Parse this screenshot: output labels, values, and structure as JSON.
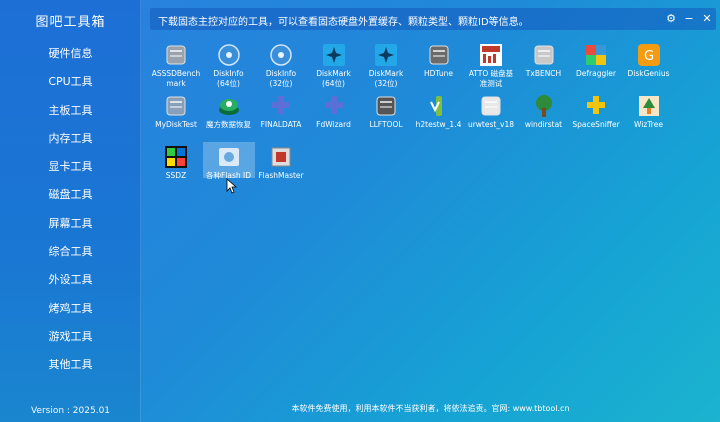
{
  "app": {
    "title": "图吧工具箱",
    "version": "Version : 2025.01"
  },
  "sidebar": {
    "items": [
      {
        "label": "硬件信息"
      },
      {
        "label": "CPU工具"
      },
      {
        "label": "主板工具"
      },
      {
        "label": "内存工具"
      },
      {
        "label": "显卡工具"
      },
      {
        "label": "磁盘工具"
      },
      {
        "label": "屏幕工具"
      },
      {
        "label": "综合工具"
      },
      {
        "label": "外设工具"
      },
      {
        "label": "烤鸡工具"
      },
      {
        "label": "游戏工具"
      },
      {
        "label": "其他工具"
      }
    ]
  },
  "header": {
    "description": "下载固态主控对应的工具，可以查看固态硬盘外置缓存、颗粒类型、颗粒ID等信息。",
    "settings": "⚙",
    "minimize": "−",
    "close": "✕"
  },
  "tools": [
    {
      "label": "ASSSDBench\nmark",
      "icon": "asssd-icon",
      "color": "#9aa3ad"
    },
    {
      "label": "DiskInfo\n(64位)",
      "icon": "diskinfo-icon",
      "color": "#3b8fd8"
    },
    {
      "label": "DiskInfo\n(32位)",
      "icon": "diskinfo-icon",
      "color": "#3b8fd8"
    },
    {
      "label": "DiskMark\n(64位)",
      "icon": "diskmark-icon",
      "color": "#22a7e8"
    },
    {
      "label": "DiskMark\n(32位)",
      "icon": "diskmark-icon",
      "color": "#22a7e8"
    },
    {
      "label": "HDTune",
      "icon": "hdtune-icon",
      "color": "#6b6b6b"
    },
    {
      "label": "ATTO 磁盘基\n准测试",
      "icon": "atto-icon",
      "color": "#c0392b"
    },
    {
      "label": "TxBENCH",
      "icon": "txbench-icon",
      "color": "#c8c8c8"
    },
    {
      "label": "Defraggler",
      "icon": "defraggler-icon",
      "color": "#e74c3c"
    },
    {
      "label": "DiskGenius",
      "icon": "diskgenius-icon",
      "color": "#f39c12"
    },
    {
      "label": "MyDiskTest",
      "icon": "mydisktest-icon",
      "color": "#8aa0b8"
    },
    {
      "label": "魔方数据恢复",
      "icon": "cube-recovery-icon",
      "color": "#27ae60"
    },
    {
      "label": "FINALDATA",
      "icon": "puzzle-icon",
      "color": "#5b6fd6"
    },
    {
      "label": "FdWizard",
      "icon": "puzzle-icon",
      "color": "#5b6fd6"
    },
    {
      "label": "LLFTOOL",
      "icon": "llftool-icon",
      "color": "#555555"
    },
    {
      "label": "h2testw_1.4",
      "icon": "h2testw-icon",
      "color": "#7fbf3f"
    },
    {
      "label": "urwtest_v18",
      "icon": "urwtest-icon",
      "color": "#e8e8e8"
    },
    {
      "label": "windirstat",
      "icon": "windirstat-icon",
      "color": "#2e8b3a"
    },
    {
      "label": "SpaceSniffer",
      "icon": "spacesniffer-icon",
      "color": "#f1c40f"
    },
    {
      "label": "WizTree",
      "icon": "wiztree-icon",
      "color": "#e67e22"
    },
    {
      "label": "SSDZ",
      "icon": "ssdz-icon",
      "color": "#1e7a2e"
    },
    {
      "label": "各种Flash ID",
      "icon": "flash-id-icon",
      "color": "#6aa8e0"
    },
    {
      "label": "FlashMaster",
      "icon": "flashmaster-icon",
      "color": "#c0392b"
    }
  ],
  "footer": {
    "text": "本软件免费使用，利用本软件不当获利者，将依法追责。官网: www.tbtool.cn"
  }
}
